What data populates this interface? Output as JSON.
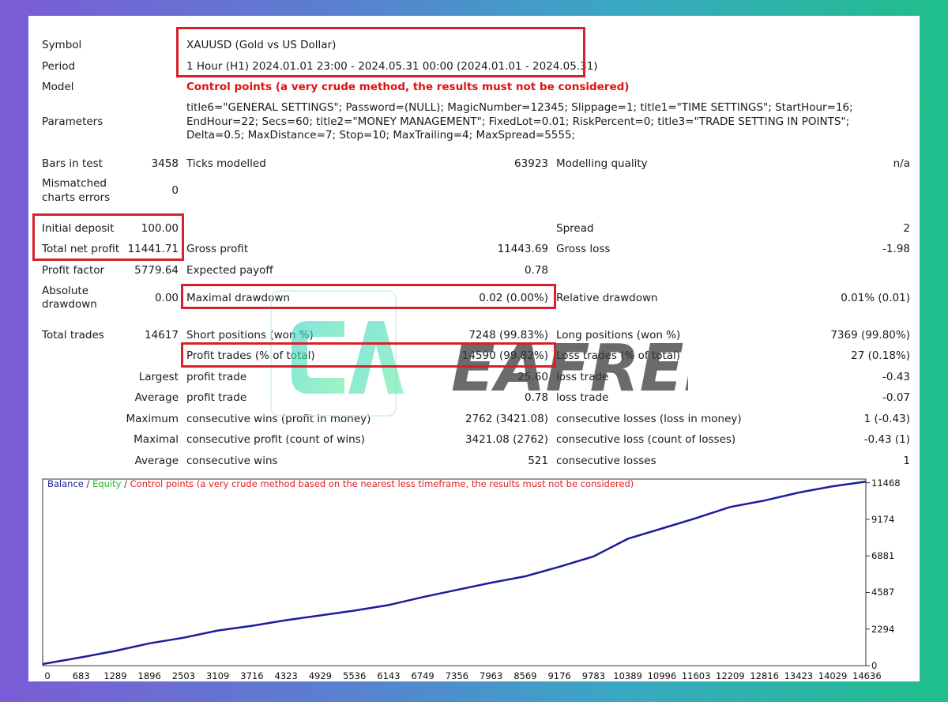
{
  "report": {
    "symbol": {
      "label": "Symbol",
      "value": "XAUUSD (Gold vs US Dollar)"
    },
    "period": {
      "label": "Period",
      "value": "1 Hour (H1) 2024.01.01 23:00 - 2024.05.31 00:00 (2024.01.01 - 2024.05.31)"
    },
    "model": {
      "label": "Model",
      "value": "Control points (a very crude method, the results must not be considered)"
    },
    "parameters": {
      "label": "Parameters",
      "value": "title6=\"GENERAL SETTINGS\"; Password=(NULL); MagicNumber=12345; Slippage=1; title1=\"TIME SETTINGS\"; StartHour=16; EndHour=22; Secs=60; title2=\"MONEY MANAGEMENT\"; FixedLot=0.01; RiskPercent=0; title3=\"TRADE SETTING IN POINTS\"; Delta=0.5; MaxDistance=7; Stop=10; MaxTrailing=4; MaxSpread=5555;"
    },
    "bars_in_test": {
      "label": "Bars in test",
      "value": "3458"
    },
    "ticks_modelled": {
      "label": "Ticks modelled",
      "value": "63923"
    },
    "modelling_quality": {
      "label": "Modelling quality",
      "value": "n/a"
    },
    "mismatched": {
      "label_line1": "Mismatched",
      "label_line2": "charts errors",
      "value": "0"
    },
    "initial_deposit": {
      "label": "Initial deposit",
      "value": "100.00"
    },
    "spread": {
      "label": "Spread",
      "value": "2"
    },
    "total_net_profit": {
      "label": "Total net profit",
      "value": "11441.71"
    },
    "gross_profit": {
      "label": "Gross profit",
      "value": "11443.69"
    },
    "gross_loss": {
      "label": "Gross loss",
      "value": "-1.98"
    },
    "profit_factor": {
      "label": "Profit factor",
      "value": "5779.64"
    },
    "expected_payoff": {
      "label": "Expected payoff",
      "value": "0.78"
    },
    "absolute_drawdown": {
      "label_line1": "Absolute",
      "label_line2": "drawdown",
      "value": "0.00"
    },
    "maximal_drawdown": {
      "label": "Maximal drawdown",
      "value": "0.02 (0.00%)"
    },
    "relative_drawdown": {
      "label": "Relative drawdown",
      "value": "0.01% (0.01)"
    },
    "total_trades": {
      "label": "Total trades",
      "value": "14617"
    },
    "short_positions": {
      "label": "Short positions (won %)",
      "value": "7248 (99.83%)"
    },
    "long_positions": {
      "label": "Long positions (won %)",
      "value": "7369 (99.80%)"
    },
    "profit_trades": {
      "label": "Profit trades (% of total)",
      "value": "14590 (99.82%)"
    },
    "loss_trades": {
      "label": "Loss trades (% of total)",
      "value": "27 (0.18%)"
    },
    "largest": {
      "label": "Largest",
      "profit_label": "profit trade",
      "profit_value": "25.60",
      "loss_label": "loss trade",
      "loss_value": "-0.43"
    },
    "average": {
      "label": "Average",
      "profit_label": "profit trade",
      "profit_value": "0.78",
      "loss_label": "loss trade",
      "loss_value": "-0.07"
    },
    "maximum": {
      "label": "Maximum",
      "wins_label": "consecutive wins (profit in money)",
      "wins_value": "2762 (3421.08)",
      "losses_label": "consecutive losses (loss in money)",
      "losses_value": "1 (-0.43)"
    },
    "maximal": {
      "label": "Maximal",
      "wins_label": "consecutive profit (count of wins)",
      "wins_value": "3421.08 (2762)",
      "losses_label": "consecutive loss (count of losses)",
      "losses_value": "-0.43 (1)"
    },
    "average_consec": {
      "label": "Average",
      "wins_label": "consecutive wins",
      "wins_value": "521",
      "losses_label": "consecutive losses",
      "losses_value": "1"
    }
  },
  "watermark": {
    "text": "EAFREE"
  },
  "chart_legend": {
    "balance": "Balance",
    "sep1": " / ",
    "equity": "Equity",
    "sep2": " / ",
    "control": "Control points (a very crude method based on the nearest less timeframe, the results must not be considered)"
  },
  "colors": {
    "balance": "#1c1c9c",
    "equity": "#29b529",
    "control": "#e02020",
    "highlight": "#d8202a"
  },
  "chart_data": {
    "type": "line",
    "x_ticks": [
      0,
      683,
      1289,
      1896,
      2503,
      3109,
      3716,
      4323,
      4929,
      5536,
      6143,
      6749,
      7356,
      7963,
      8569,
      9176,
      9783,
      10389,
      10996,
      11603,
      12209,
      12816,
      13423,
      14029,
      14636
    ],
    "y_ticks": [
      0,
      2294,
      4587,
      6881,
      9174,
      11468
    ],
    "xlim": [
      0,
      14617
    ],
    "ylim": [
      0,
      11700
    ],
    "series": [
      {
        "name": "Balance",
        "x": [
          0,
          683,
          1289,
          1896,
          2503,
          3109,
          3716,
          4323,
          4929,
          5536,
          6143,
          6749,
          7356,
          7963,
          8569,
          9176,
          9783,
          10389,
          10996,
          11603,
          12209,
          12816,
          13423,
          14029,
          14617
        ],
        "values": [
          100,
          520,
          920,
          1400,
          1750,
          2200,
          2500,
          2850,
          3150,
          3450,
          3800,
          4300,
          4750,
          5200,
          5600,
          6200,
          6850,
          7950,
          8600,
          9250,
          9950,
          10350,
          10850,
          11250,
          11541
        ]
      }
    ]
  }
}
